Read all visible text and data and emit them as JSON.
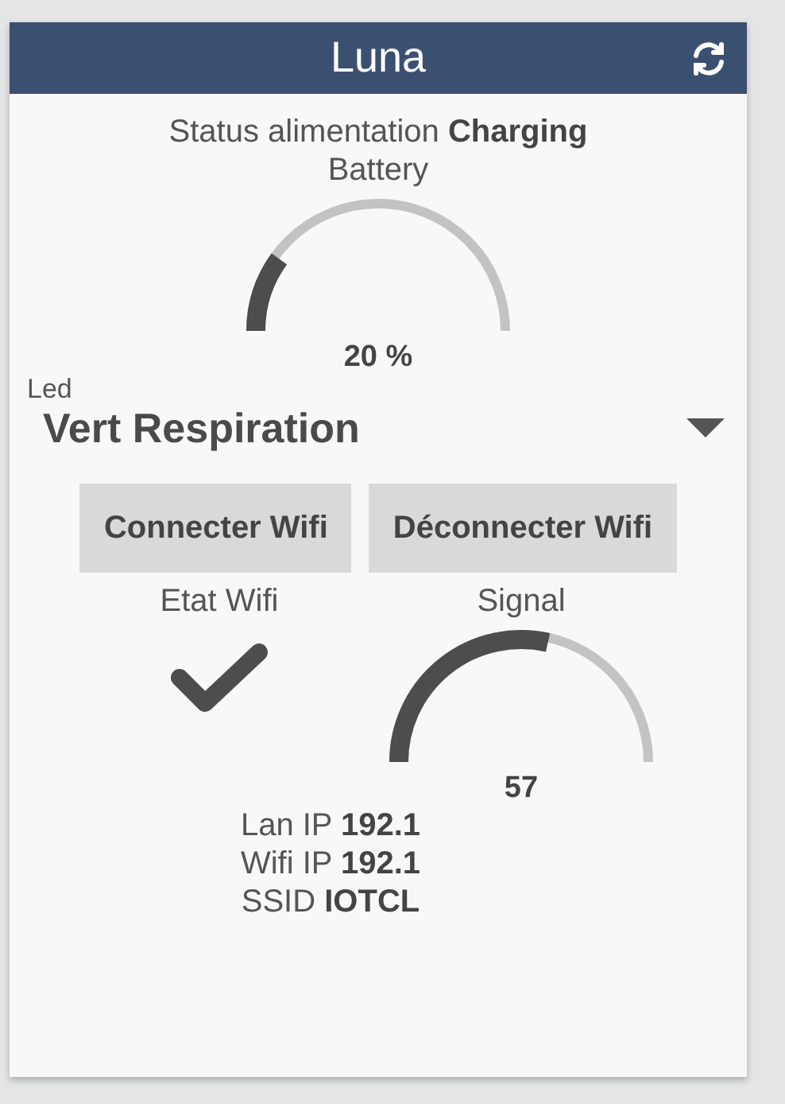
{
  "header": {
    "title": "Luna"
  },
  "power_status": "Status alimentation **Charging**",
  "battery": {
    "label": "Battery",
    "reading": "20 %"
  },
  "led": {
    "label": "Led",
    "value": "Vert Respiration"
  },
  "buttons": [
    {
      "label": "Connecter Wifi"
    },
    {
      "label": "Déconnecter Wifi"
    }
  ],
  "wifi_state": {
    "label": "Etat Wifi",
    "connected": true
  },
  "signal": {
    "label": "Signal",
    "reading": "57"
  },
  "info": [
    {
      "text": "Lan IP **192.1**"
    },
    {
      "text": "Wifi IP **192.1**"
    },
    {
      "text": "SSID **IOTCL**"
    }
  ]
}
